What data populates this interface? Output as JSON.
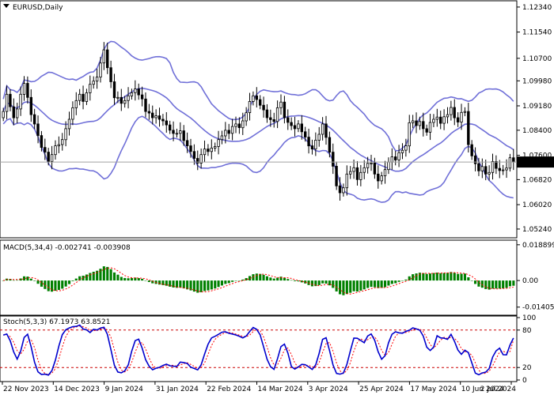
{
  "chart_data": [
    {
      "type": "candlestick",
      "title": "EURUSD,Daily",
      "symbol": "EURUSD",
      "timeframe": "Daily",
      "indicator": "Bollinger Bands",
      "current_price": "1.07383",
      "y_ticks": [
        "1.12340",
        "1.11540",
        "1.10700",
        "1.09980",
        "1.09180",
        "1.08400",
        "1.07600",
        "1.06820",
        "1.06020",
        "1.05240"
      ],
      "ylim": [
        1.0496,
        1.1254
      ],
      "x_ticks": [
        "22 Nov 2023",
        "14 Dec 2023",
        "9 Jan 2024",
        "31 Jan 2024",
        "22 Feb 2024",
        "14 Mar 2024",
        "3 Apr 2024",
        "25 Apr 2024",
        "17 May 2024",
        "10 Jun 2024",
        "2 Jul 2024"
      ],
      "close": [
        1.09,
        1.0955,
        1.0915,
        1.088,
        1.0908,
        1.0955,
        1.099,
        1.0945,
        1.089,
        1.086,
        1.0823,
        1.0785,
        1.077,
        1.074,
        1.0762,
        1.079,
        1.0794,
        1.081,
        1.0845,
        1.0875,
        1.0912,
        1.0935,
        1.0955,
        1.0932,
        1.096,
        1.0987,
        1.0997,
        1.101,
        1.1055,
        1.1097,
        1.104,
        1.0995,
        1.0944,
        1.0945,
        1.0926,
        1.0935,
        1.095,
        1.096,
        1.0972,
        1.0953,
        1.094,
        1.09,
        1.0895,
        1.088,
        1.0886,
        1.0875,
        1.087,
        1.0857,
        1.084,
        1.083,
        1.083,
        1.0838,
        1.0807,
        1.079,
        1.0772,
        1.075,
        1.0735,
        1.0762,
        1.078,
        1.0772,
        1.0783,
        1.0788,
        1.081,
        1.0822,
        1.084,
        1.083,
        1.0852,
        1.086,
        1.0848,
        1.087,
        1.0896,
        1.0932,
        1.095,
        1.0938,
        1.092,
        1.0905,
        1.088,
        1.0874,
        1.0868,
        1.0912,
        1.093,
        1.088,
        1.0865,
        1.0855,
        1.0845,
        1.086,
        1.0835,
        1.0818,
        1.079,
        1.078,
        1.0808,
        1.0827,
        1.086,
        1.0817,
        1.077,
        1.0725,
        1.0662,
        1.064,
        1.0656,
        1.07,
        1.0708,
        1.072,
        1.0682,
        1.0705,
        1.072,
        1.0734,
        1.0735,
        1.07,
        1.0678,
        1.0694,
        1.0714,
        1.0738,
        1.0755,
        1.0745,
        1.0768,
        1.0776,
        1.079,
        1.0864,
        1.087,
        1.0855,
        1.0868,
        1.0845,
        1.0834,
        1.0865,
        1.0875,
        1.0882,
        1.0862,
        1.0883,
        1.089,
        1.0913,
        1.088,
        1.0866,
        1.0897,
        1.09,
        1.0794,
        1.0758,
        1.0733,
        1.071,
        1.0724,
        1.07,
        1.0705,
        1.074,
        1.0718,
        1.0711,
        1.0713,
        1.0719,
        1.0752,
        1.0738
      ],
      "bollinger_bands": [
        "upper",
        "middle",
        "lower"
      ],
      "grid": false
    },
    {
      "type": "bar",
      "title": "MACD(5,34,4) -0.002741 -0.003908",
      "indicator": "MACD",
      "params": [
        5,
        34,
        4
      ],
      "main_value": -0.002741,
      "signal_value": -0.003908,
      "y_ticks": [
        "0.018899",
        "0.00",
        "-0.014051"
      ],
      "ylim": [
        -0.0175,
        0.0205
      ],
      "signal_line_style": "dotted"
    },
    {
      "type": "line",
      "title": "Stoch(5,3,3) 67.1973 63.8521",
      "indicator": "Stochastic",
      "params": [
        5,
        3,
        3
      ],
      "main_value": 67.1973,
      "signal_value": 63.8521,
      "y_ticks": [
        "100",
        "80",
        "20",
        "0"
      ],
      "levels": [
        80,
        20
      ],
      "ylim": [
        0,
        100
      ]
    }
  ],
  "colors": {
    "bullish_candle": "#ffffff",
    "bearish_candle": "#000000",
    "bollinger": "#7070d8",
    "macd_histogram": "#008000",
    "macd_signal": "#ff0000",
    "stoch_main": "#0000cd",
    "stoch_signal": "#ff0000",
    "price_label_bg": "#000000"
  }
}
